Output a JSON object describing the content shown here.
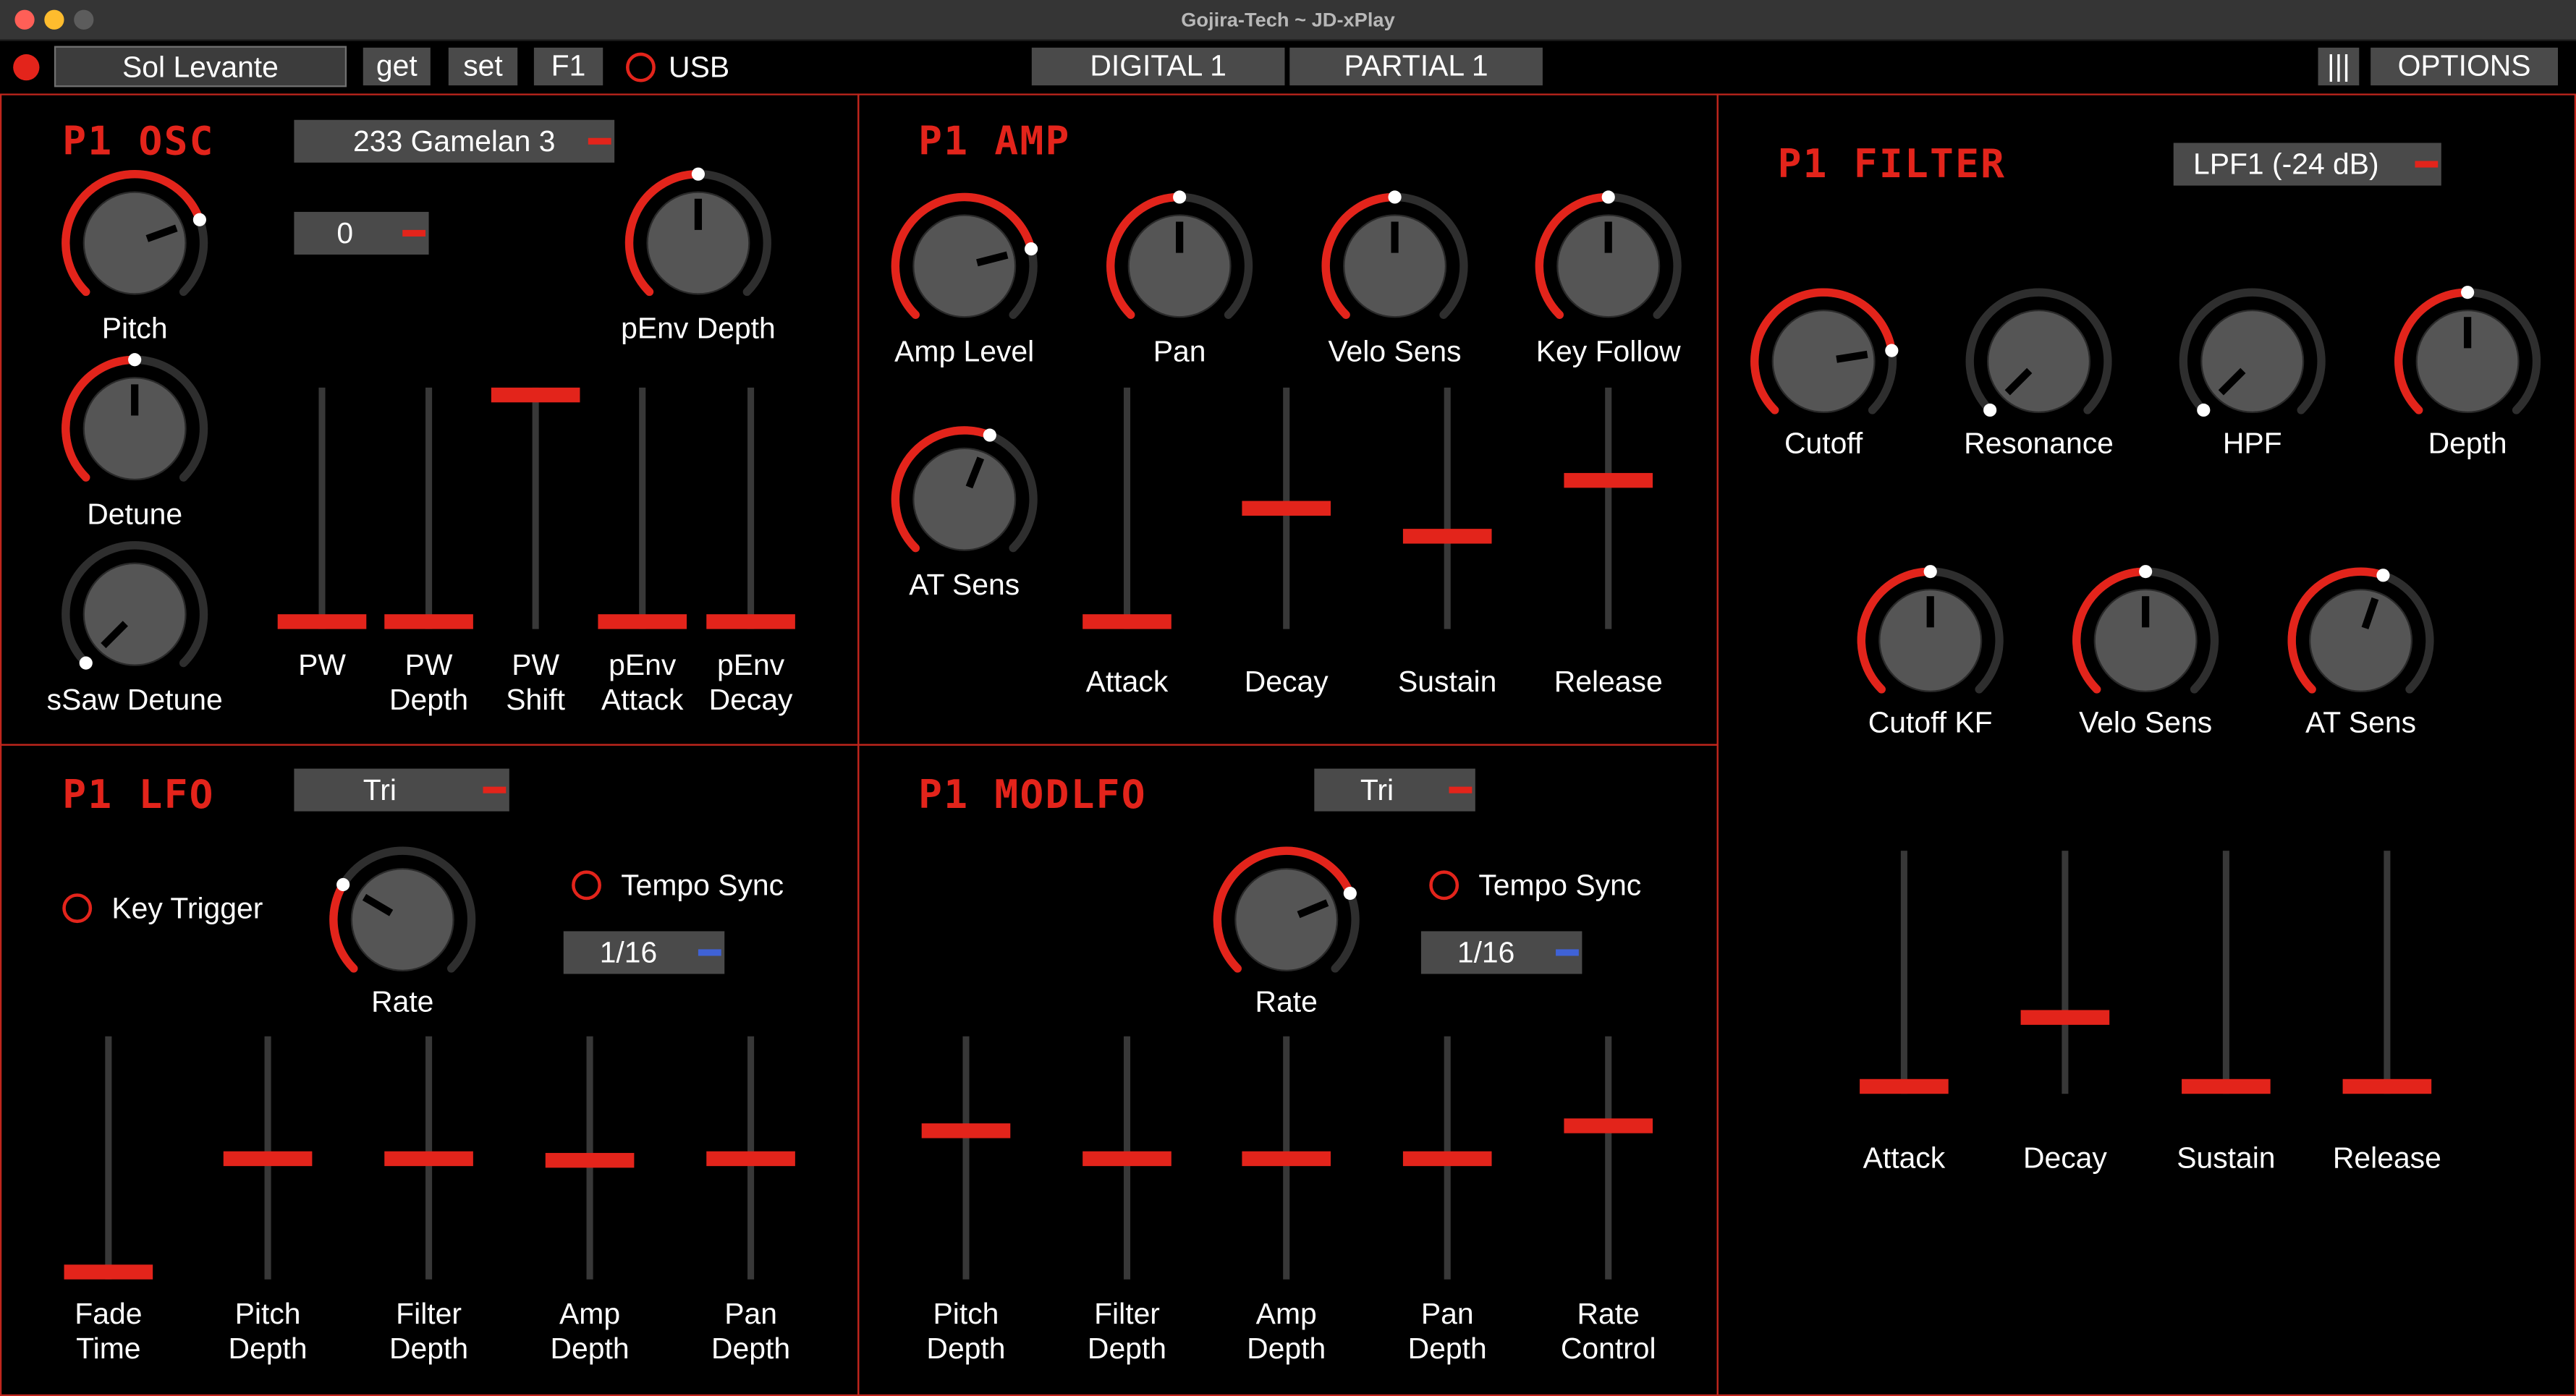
{
  "window": {
    "title": "Gojira-Tech ~ JD-xPlay"
  },
  "toolbar": {
    "preset_name": "Sol Levante",
    "get_label": "get",
    "set_label": "set",
    "f1_label": "F1",
    "usb_label": "USB",
    "digital_tab": "DIGITAL 1",
    "partial_tab": "PARTIAL 1",
    "bars_label": "|||",
    "options_label": "OPTIONS"
  },
  "colors": {
    "accent": "#e3241b",
    "knob": "#555555",
    "track": "#383838",
    "combo": "#4a4a4a",
    "blue_marker": "#3f62d6"
  },
  "osc": {
    "title": "P1 OSC",
    "waveform": "233 Gamelan 3",
    "wave_gain": "0",
    "knobs": [
      {
        "label": "Pitch",
        "value": 0.76
      },
      {
        "label": "Detune",
        "value": 0.5
      },
      {
        "label": "sSaw Detune",
        "value": 0.0
      },
      {
        "label": "pEnv Depth",
        "value": 0.5
      }
    ],
    "sliders": [
      {
        "label_1": "PW",
        "label_2": "",
        "value": 0.0
      },
      {
        "label_1": "PW",
        "label_2": "Depth",
        "value": 0.0
      },
      {
        "label_1": "PW",
        "label_2": "Shift",
        "value": 1.0
      },
      {
        "label_1": "pEnv",
        "label_2": "Attack",
        "value": 0.0
      },
      {
        "label_1": "pEnv",
        "label_2": "Decay",
        "value": 0.0
      }
    ]
  },
  "amp": {
    "title": "P1 AMP",
    "knobs": [
      {
        "label": "Amp Level",
        "value": 0.78
      },
      {
        "label": "Pan",
        "value": 0.5
      },
      {
        "label": "Velo Sens",
        "value": 0.5
      },
      {
        "label": "Key Follow",
        "value": 0.5
      },
      {
        "label": "AT Sens",
        "value": 0.58
      }
    ],
    "sliders": [
      {
        "label_1": "Attack",
        "label_2": "",
        "value": 0.0
      },
      {
        "label_1": "Decay",
        "label_2": "",
        "value": 0.5
      },
      {
        "label_1": "Sustain",
        "label_2": "",
        "value": 0.38
      },
      {
        "label_1": "Release",
        "label_2": "",
        "value": 0.62
      }
    ]
  },
  "filter": {
    "title": "P1 FILTER",
    "type": "LPF1 (-24 dB)",
    "knobs": [
      {
        "label": "Cutoff",
        "value": 0.8
      },
      {
        "label": "Resonance",
        "value": 0.0
      },
      {
        "label": "HPF",
        "value": 0.0
      },
      {
        "label": "Depth",
        "value": 0.5
      },
      {
        "label": "Cutoff KF",
        "value": 0.5
      },
      {
        "label": "Velo Sens",
        "value": 0.5
      },
      {
        "label": "AT Sens",
        "value": 0.57
      }
    ],
    "sliders": [
      {
        "label_1": "Attack",
        "label_2": "",
        "value": 0.0
      },
      {
        "label_1": "Decay",
        "label_2": "",
        "value": 0.3
      },
      {
        "label_1": "Sustain",
        "label_2": "",
        "value": 0.0
      },
      {
        "label_1": "Release",
        "label_2": "",
        "value": 0.0
      }
    ]
  },
  "lfo": {
    "title": "P1 LFO",
    "shape": "Tri",
    "key_trigger_label": "Key Trigger",
    "tempo_sync_label": "Tempo Sync",
    "sync_note": "1/16",
    "rate": {
      "label": "Rate",
      "value": 0.28
    },
    "sliders": [
      {
        "label_1": "Fade",
        "label_2": "Time",
        "value": 0.0
      },
      {
        "label_1": "Pitch",
        "label_2": "Depth",
        "value": 0.5
      },
      {
        "label_1": "Filter",
        "label_2": "Depth",
        "value": 0.5
      },
      {
        "label_1": "Amp",
        "label_2": "Depth",
        "value": 0.49
      },
      {
        "label_1": "Pan",
        "label_2": "Depth",
        "value": 0.5
      }
    ]
  },
  "modlfo": {
    "title": "P1 MODLFO",
    "shape": "Tri",
    "tempo_sync_label": "Tempo Sync",
    "sync_note": "1/16",
    "rate": {
      "label": "Rate",
      "value": 0.75
    },
    "sliders": [
      {
        "label_1": "Pitch",
        "label_2": "Depth",
        "value": 0.62
      },
      {
        "label_1": "Filter",
        "label_2": "Depth",
        "value": 0.5
      },
      {
        "label_1": "Amp",
        "label_2": "Depth",
        "value": 0.5
      },
      {
        "label_1": "Pan",
        "label_2": "Depth",
        "value": 0.5
      },
      {
        "label_1": "Rate",
        "label_2": "Control",
        "value": 0.64
      }
    ]
  }
}
